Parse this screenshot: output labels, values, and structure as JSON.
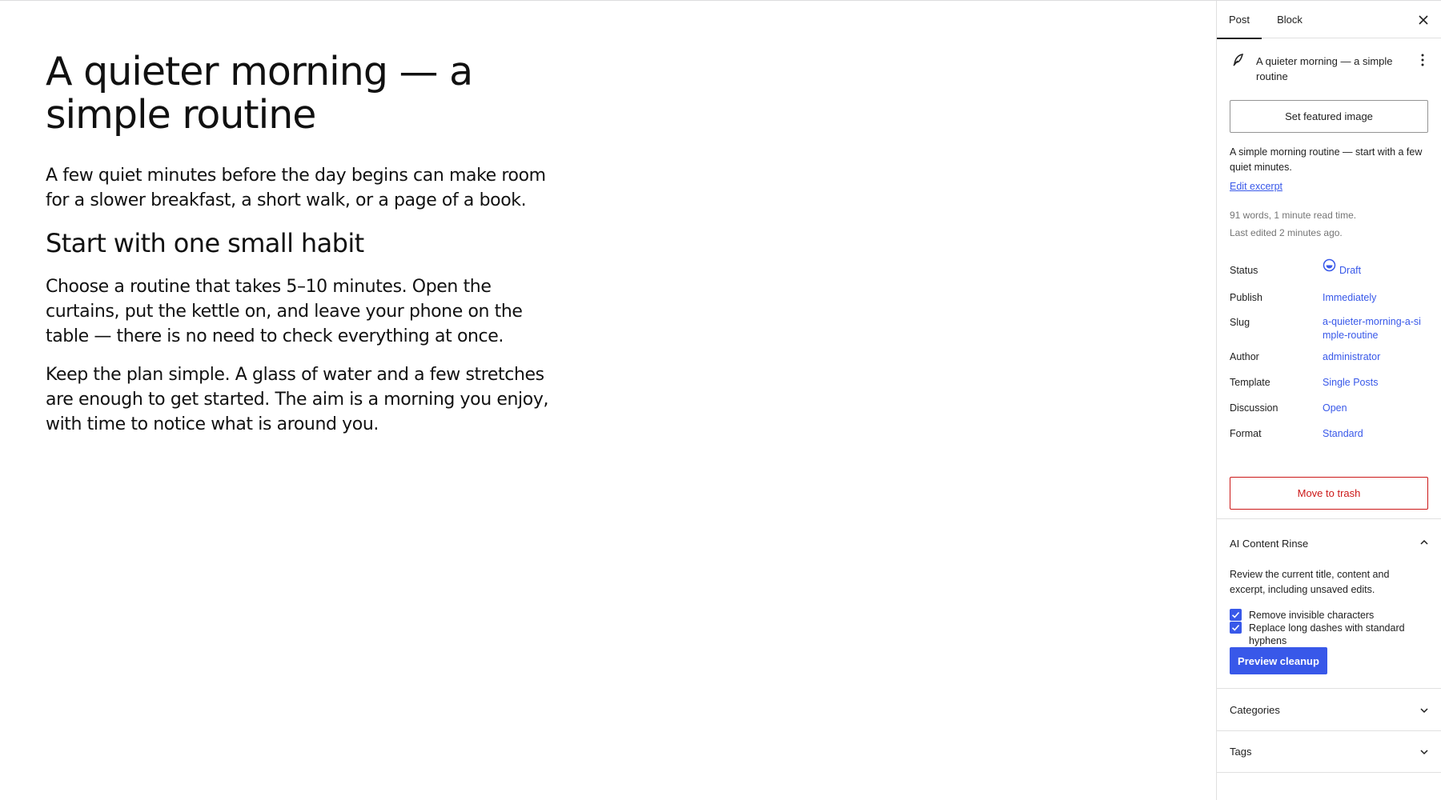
{
  "editor": {
    "title": "A quieter morning — a simple routine",
    "paragraphs": [
      "A few quiet minutes before the day begins can make room for a slower breakfast, a short walk, or a page of a book.",
      "Choose a routine that takes 5–10 minutes. Open the curtains, put the kettle on, and leave your phone on the table — there is no need to check everything at once.",
      "Keep the plan simple. A glass of water and a few stretches are enough to get started. The aim is a morning you enjoy, with time to notice what is around you."
    ],
    "heading": "Start with one small habit"
  },
  "sidebar": {
    "tabs": {
      "post": "Post",
      "block": "Block"
    },
    "close_icon": "close-icon",
    "post_card": {
      "title": "A quieter morning — a simple routine",
      "icon": "feather-icon",
      "featured_image_label": "Set featured image",
      "excerpt": "A simple morning routine — start with a few quiet minutes.",
      "edit_excerpt": "Edit excerpt",
      "word_count": "91 words, 1 minute read time.",
      "last_edited": "Last edited 2 minutes ago."
    },
    "rows": {
      "status": {
        "label": "Status",
        "value": "Draft"
      },
      "publish": {
        "label": "Publish",
        "value": "Immediately"
      },
      "slug": {
        "label": "Slug",
        "value": "a-quieter-morning-a-simple-routine"
      },
      "author": {
        "label": "Author",
        "value": "administrator"
      },
      "template": {
        "label": "Template",
        "value": "Single Posts"
      },
      "discussion": {
        "label": "Discussion",
        "value": "Open"
      },
      "format": {
        "label": "Format",
        "value": "Standard"
      }
    },
    "trash_label": "Move to trash",
    "rinse": {
      "title": "AI Content Rinse",
      "description": "Review the current title, content and excerpt, including unsaved edits.",
      "options": [
        {
          "label": "Remove invisible characters",
          "checked": true
        },
        {
          "label": "Replace long dashes with standard hyphens",
          "checked": true
        }
      ],
      "button": "Preview cleanup"
    },
    "categories": "Categories",
    "tags": "Tags"
  },
  "colors": {
    "accent": "#3858e9",
    "danger": "#cc1818",
    "border": "#e0e0e0",
    "muted": "#757575"
  }
}
